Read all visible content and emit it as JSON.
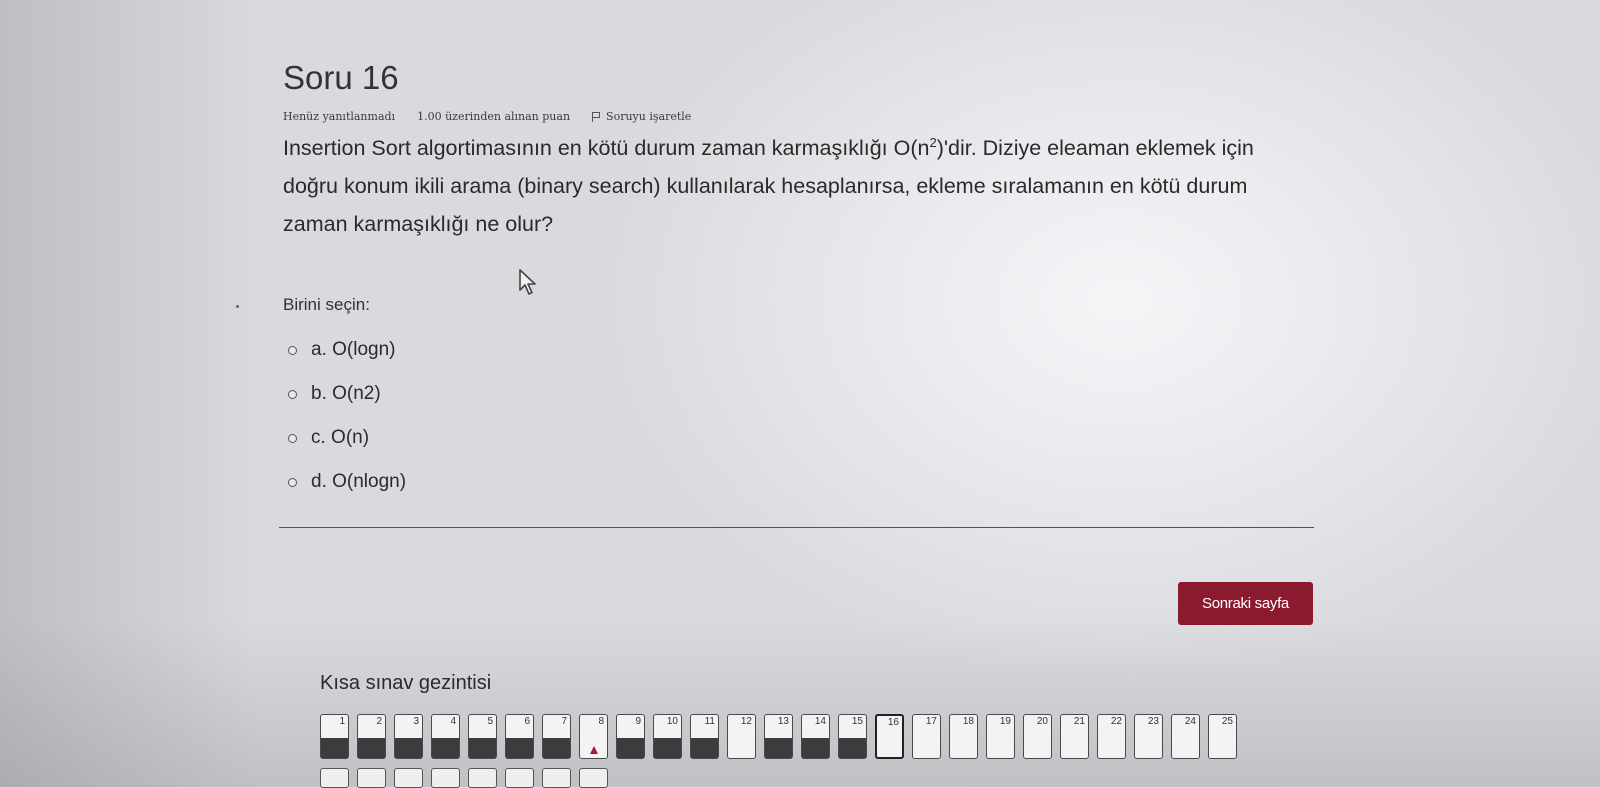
{
  "question": {
    "title": "Soru 16",
    "status": "Henüz yanıtlanmadı",
    "points": "1.00 üzerinden alınan puan",
    "flag_label": "Soruyu işaretle",
    "text_part1": "Insertion Sort algortimasının en kötü durum zaman karmaşıklığı O(n",
    "text_sup": "2",
    "text_part2": ")'dir. Diziye eleaman eklemek için doğru konum ikili arama (binary search) kullanılarak hesaplanırsa, ekleme sıralamanın en kötü durum zaman karmaşıklığı ne olur?"
  },
  "answers": {
    "prompt": "Birini seçin:",
    "options": [
      {
        "label": "a. O(logn)"
      },
      {
        "label": "b. O(n2)"
      },
      {
        "label": "c. O(n)"
      },
      {
        "label": "d. O(nlogn)"
      }
    ]
  },
  "next_button": {
    "label": "Sonraki sayfa",
    "color": "#8b1a2e"
  },
  "navigation": {
    "title": "Kısa sınav gezintisi",
    "items": [
      {
        "num": "1",
        "state": "answered"
      },
      {
        "num": "2",
        "state": "answered"
      },
      {
        "num": "3",
        "state": "answered"
      },
      {
        "num": "4",
        "state": "answered"
      },
      {
        "num": "5",
        "state": "answered"
      },
      {
        "num": "6",
        "state": "answered"
      },
      {
        "num": "7",
        "state": "answered"
      },
      {
        "num": "8",
        "state": "flagged"
      },
      {
        "num": "9",
        "state": "answered"
      },
      {
        "num": "10",
        "state": "answered"
      },
      {
        "num": "11",
        "state": "answered"
      },
      {
        "num": "12",
        "state": "unanswered"
      },
      {
        "num": "13",
        "state": "answered"
      },
      {
        "num": "14",
        "state": "answered"
      },
      {
        "num": "15",
        "state": "answered"
      },
      {
        "num": "16",
        "state": "current"
      },
      {
        "num": "17",
        "state": "unanswered"
      },
      {
        "num": "18",
        "state": "unanswered"
      },
      {
        "num": "19",
        "state": "unanswered"
      },
      {
        "num": "20",
        "state": "unanswered"
      },
      {
        "num": "21",
        "state": "unanswered"
      },
      {
        "num": "22",
        "state": "unanswered"
      },
      {
        "num": "23",
        "state": "unanswered"
      },
      {
        "num": "24",
        "state": "unanswered"
      },
      {
        "num": "25",
        "state": "unanswered"
      }
    ]
  }
}
